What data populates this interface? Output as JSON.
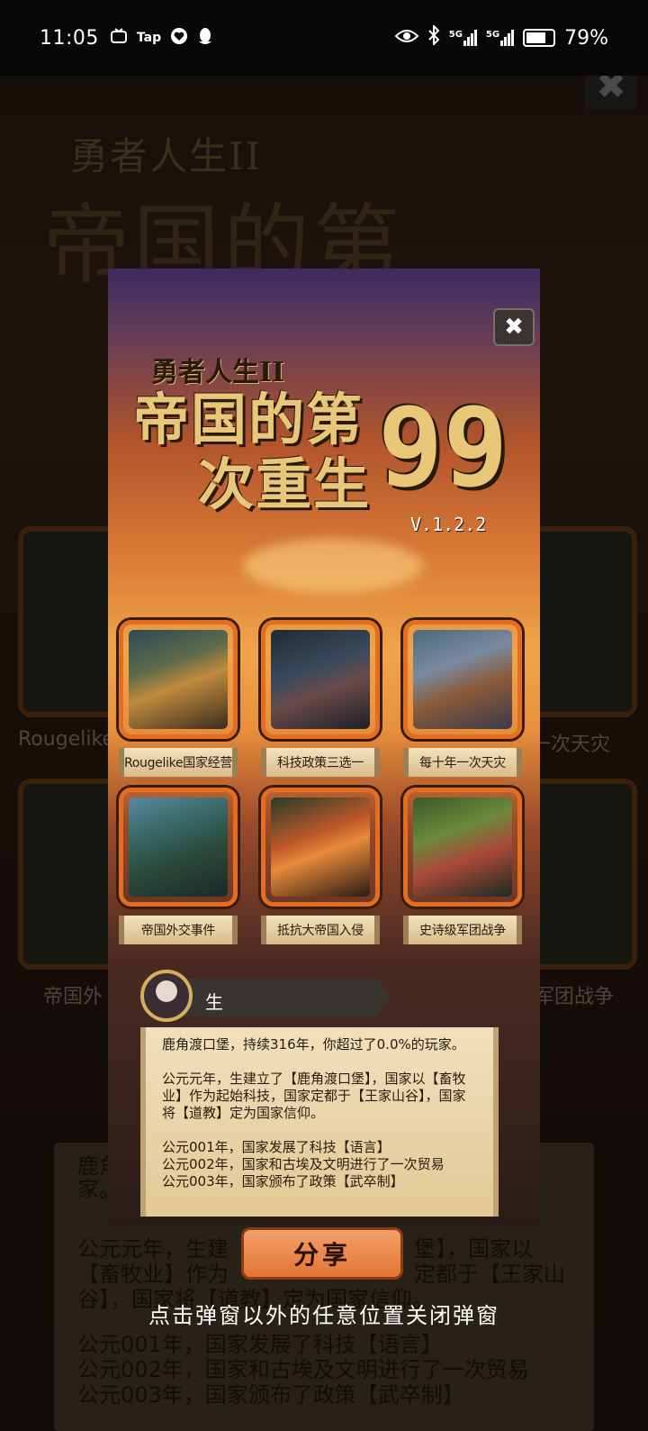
{
  "status_bar": {
    "time": "11:05",
    "left_icons": [
      "tv-icon",
      "tap-icon",
      "heart-shield-icon",
      "qq-icon"
    ],
    "tap_label": "Tap",
    "right_icons": [
      "eye-icon",
      "bluetooth-icon",
      "signal-5g-icon",
      "signal-5g-icon",
      "battery-icon"
    ],
    "net1": "5G",
    "net2": "5G",
    "battery_level": 0.79,
    "battery_text": "79%"
  },
  "background": {
    "title_small": "勇者人生II",
    "title_big": "帝国的第",
    "close": "✖",
    "label_left_1": "Rougelike",
    "label_right_1": "一次天灾",
    "label_left_2": "帝国外",
    "label_right_2": "军团战争",
    "text_1": "鹿角",
    "text_2": "家。",
    "text_3": "公元元年，生建",
    "text_3b": "堡】，国家以",
    "text_4": "【畜牧业】作为",
    "text_4b": "定都于【王家山",
    "text_5": "谷】，国家将【道教】定为国家信仰。",
    "text_6": "公元001年，国家发展了科技【语言】",
    "text_7": "公元002年，国家和古埃及文明进行了一次贸易",
    "text_8": "公元003年，国家颁布了政策【武卒制】"
  },
  "popup": {
    "close_icon": "✖",
    "logo_sub": "勇者人生II",
    "logo_line1": "帝国的第",
    "logo_line2": "次重生",
    "logo_number": "99",
    "version": "V.1.2.2",
    "features": [
      {
        "label": "Rougelike国家经营",
        "icon": "castle-town-art"
      },
      {
        "label": "科技政策三选一",
        "icon": "knight-statue-art"
      },
      {
        "label": "每十年一次天灾",
        "icon": "battle-knights-art"
      },
      {
        "label": "帝国外交事件",
        "icon": "warrior-art"
      },
      {
        "label": "抵抗大帝国入侵",
        "icon": "burning-army-art"
      },
      {
        "label": "史诗级军团战争",
        "icon": "legion-art"
      }
    ],
    "player_name": "生",
    "report": [
      "鹿角渡口堡，持续316年，你超过了0.0%的玩家。",
      "公元元年，生建立了【鹿角渡口堡】，国家以【畜牧业】作为起始科技，国家定都于【王家山谷】，国家将【道教】定为国家信仰。",
      "公元001年，国家发展了科技【语言】",
      "公元002年，国家和古埃及文明进行了一次贸易",
      "公元003年，国家颁布了政策【武卒制】"
    ],
    "colors": {
      "frame": "#e36d21",
      "parchment": "#f1e0bd"
    }
  },
  "share_label": "分享",
  "hint": "点击弹窗以外的任意位置关闭弹窗"
}
